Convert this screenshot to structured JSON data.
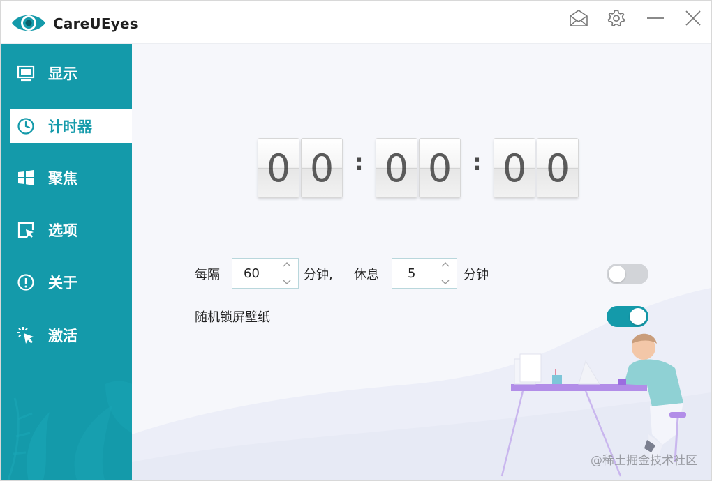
{
  "app": {
    "title": "CareUEyes"
  },
  "titlebar": {
    "mail_icon": "mail-icon",
    "settings_icon": "gear-icon",
    "minimize_icon": "minimize-icon",
    "close_icon": "close-icon"
  },
  "sidebar": {
    "items": [
      {
        "label": "显示",
        "icon": "monitor-icon",
        "active": false
      },
      {
        "label": "计时器",
        "icon": "clock-icon",
        "active": true
      },
      {
        "label": "聚焦",
        "icon": "windows-icon",
        "active": false
      },
      {
        "label": "选项",
        "icon": "cursor-box-icon",
        "active": false
      },
      {
        "label": "关于",
        "icon": "info-icon",
        "active": false
      },
      {
        "label": "激活",
        "icon": "sparkle-cursor-icon",
        "active": false
      }
    ]
  },
  "timer": {
    "digits": [
      "0",
      "0",
      "0",
      "0",
      "0",
      "0"
    ],
    "separator": ":"
  },
  "settings": {
    "interval_label": "每隔",
    "interval_value": "60",
    "interval_unit": "分钟,",
    "rest_label": "休息",
    "rest_value": "5",
    "rest_unit": "分钟",
    "timer_enabled": false,
    "random_wallpaper_label": "随机锁屏壁纸",
    "random_wallpaper_enabled": true
  },
  "watermark": "@稀土掘金技术社区",
  "colors": {
    "accent": "#149aaa",
    "sidebar": "#149aaa",
    "toggle_off": "#d2d4d8"
  }
}
